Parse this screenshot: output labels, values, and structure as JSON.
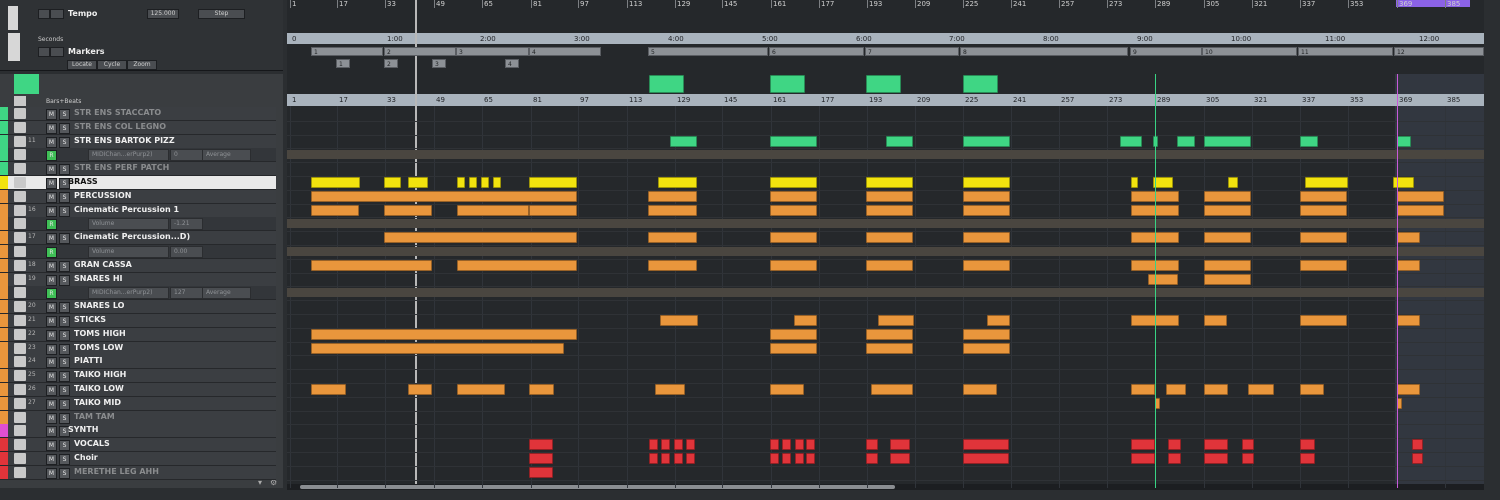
{
  "header": {
    "tempo_label": "Tempo",
    "tempo_value": "125.000",
    "tempo_mode": "Step",
    "seconds_label": "Seconds",
    "markers_label": "Markers",
    "locate_btn": "Locate",
    "cycle_btn": "Cycle",
    "zoom_btn": "Zoom",
    "bars_label": "Bars+Beats"
  },
  "top_ruler": [
    "1",
    "17",
    "33",
    "49",
    "65",
    "81",
    "97",
    "113",
    "129",
    "145",
    "161",
    "177",
    "193",
    "209",
    "225",
    "241",
    "257",
    "273",
    "289",
    "305",
    "321",
    "337",
    "353",
    "369",
    "385"
  ],
  "seconds_ruler": [
    "0",
    "1:00",
    "2:00",
    "3:00",
    "4:00",
    "5:00",
    "6:00",
    "7:00",
    "8:00",
    "9:00",
    "10:00",
    "11:00",
    "12:00"
  ],
  "bars_ruler": [
    "1",
    "17",
    "33",
    "49",
    "65",
    "81",
    "97",
    "113",
    "129",
    "145",
    "161",
    "177",
    "193",
    "209",
    "225",
    "241",
    "257",
    "273",
    "289",
    "305",
    "321",
    "337",
    "353",
    "369",
    "385"
  ],
  "markers": [
    "1",
    "2",
    "3",
    "4",
    "5",
    "6",
    "7",
    "8",
    "9",
    "10",
    "11",
    "12"
  ],
  "marker_small": [
    "1",
    "2",
    "3",
    "4"
  ],
  "tracks": [
    {
      "name": "STR ENS STACCATO",
      "num": ""
    },
    {
      "name": "STR ENS COL LEGNO",
      "num": ""
    },
    {
      "name": "STR ENS BARTOK PIZZ",
      "num": "11"
    },
    {
      "name": "MIDIChan...erPurp2)",
      "num": "",
      "sub": "0",
      "sub2": "Average"
    },
    {
      "name": "STR ENS PERF PATCH",
      "num": ""
    },
    {
      "name": "BRASS",
      "num": ""
    },
    {
      "name": "PERCUSSION",
      "num": ""
    },
    {
      "name": "Cinematic Percussion 1",
      "num": "16"
    },
    {
      "name": "Volume",
      "num": "",
      "sub": "-1.21"
    },
    {
      "name": "Cinematic Percussion...D)",
      "num": "17"
    },
    {
      "name": "Volume",
      "num": "",
      "sub": "0.00"
    },
    {
      "name": "GRAN CASSA",
      "num": "18"
    },
    {
      "name": "SNARES HI",
      "num": "19"
    },
    {
      "name": "MIDIChan...erPurp2)",
      "num": "",
      "sub": "127",
      "sub2": "Average"
    },
    {
      "name": "SNARES LO",
      "num": "20"
    },
    {
      "name": "STICKS",
      "num": "21"
    },
    {
      "name": "TOMS HIGH",
      "num": "22"
    },
    {
      "name": "TOMS LOW",
      "num": "23"
    },
    {
      "name": "PIATTI",
      "num": "24"
    },
    {
      "name": "TAIKO HIGH",
      "num": "25"
    },
    {
      "name": "TAIKO LOW",
      "num": "26"
    },
    {
      "name": "TAIKO MID",
      "num": "27"
    },
    {
      "name": "TAM TAM",
      "num": ""
    },
    {
      "name": "SYNTH",
      "num": ""
    },
    {
      "name": "VOCALS",
      "num": ""
    },
    {
      "name": "Choir",
      "num": ""
    },
    {
      "name": "MERETHE LEG AHH",
      "num": ""
    }
  ],
  "colors": {
    "orange": "#e9963c",
    "yellow": "#f2e30e",
    "green": "#3fd684",
    "red": "#e0343a",
    "synth": "#e04fd0",
    "purple_locator": "#8b62e6"
  }
}
